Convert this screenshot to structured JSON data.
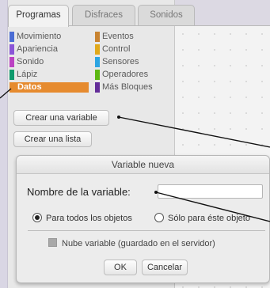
{
  "tabs": [
    {
      "label": "Programas",
      "active": true
    },
    {
      "label": "Disfraces",
      "active": false
    },
    {
      "label": "Sonidos",
      "active": false
    }
  ],
  "categories": [
    {
      "label": "Movimiento",
      "color": "#4a6cd4",
      "selected": false
    },
    {
      "label": "Apariencia",
      "color": "#8a55d7",
      "selected": false
    },
    {
      "label": "Sonido",
      "color": "#bb42c3",
      "selected": false
    },
    {
      "label": "Lápiz",
      "color": "#0e9a6c",
      "selected": false
    },
    {
      "label": "Datos",
      "color": "#ee7d16",
      "selected": true
    },
    {
      "label": "Eventos",
      "color": "#c88330",
      "selected": false
    },
    {
      "label": "Control",
      "color": "#e1a91a",
      "selected": false
    },
    {
      "label": "Sensores",
      "color": "#2ca5e2",
      "selected": false
    },
    {
      "label": "Operadores",
      "color": "#5cb712",
      "selected": false
    },
    {
      "label": "Más Bloques",
      "color": "#632d99",
      "selected": false
    }
  ],
  "buttons": {
    "make_variable": "Crear una variable",
    "make_list": "Crear una lista"
  },
  "dialog": {
    "title": "Variable nueva",
    "name_label": "Nombre de la variable:",
    "name_value": "",
    "radio_all": "Para todos los objetos",
    "radio_this": "Sólo para éste objeto",
    "radio_selected": "all",
    "cloud_label": "Nube variable (guardado en el servidor)",
    "cloud_checked": false,
    "ok": "OK",
    "cancel": "Cancelar"
  }
}
